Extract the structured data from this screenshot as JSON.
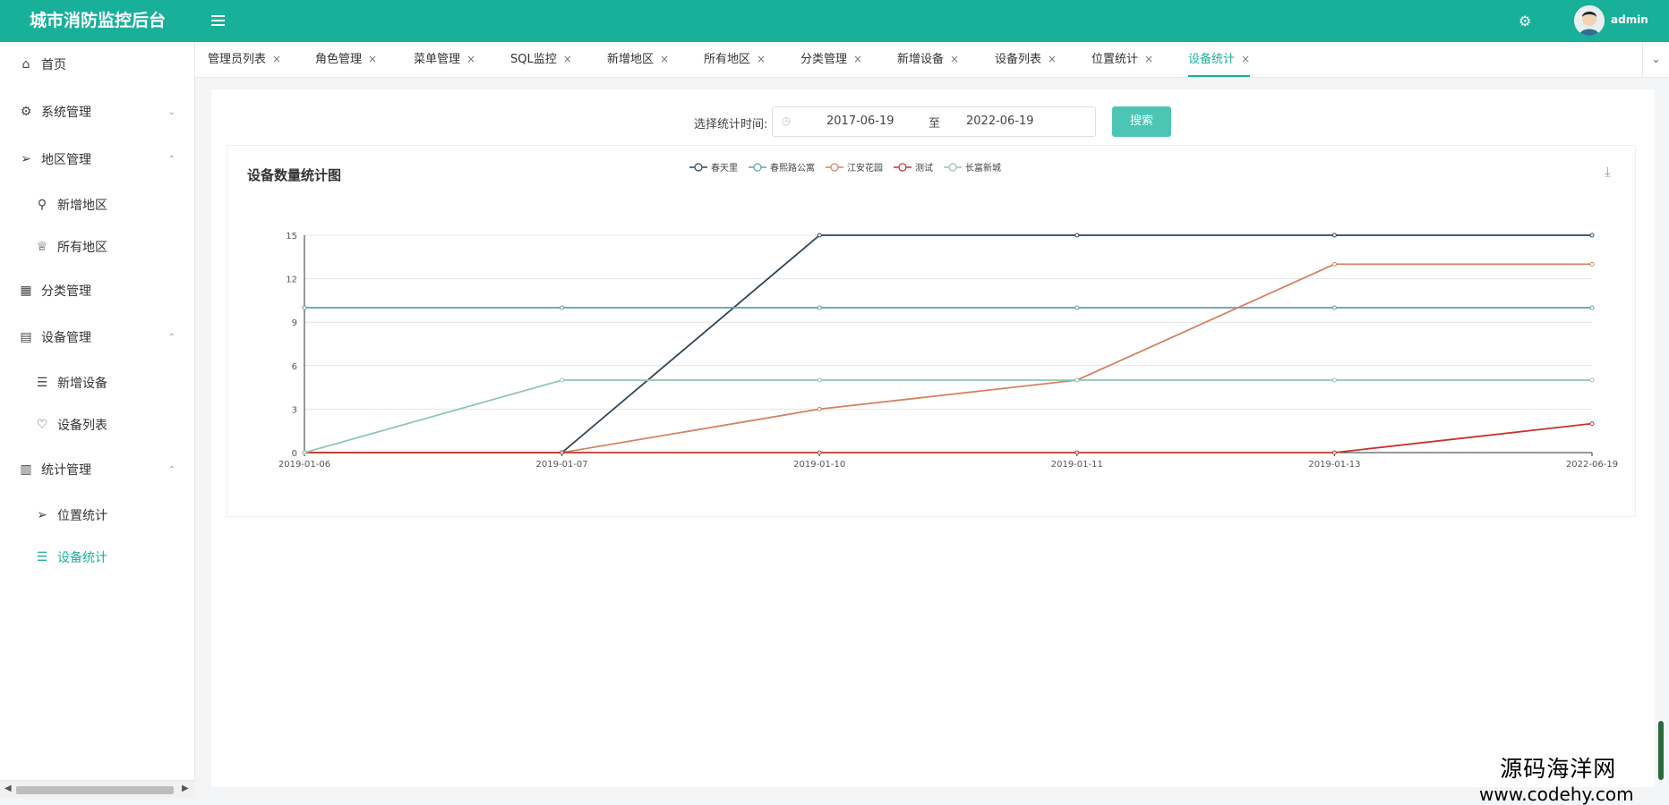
{
  "app": {
    "title": "城市消防监控后台",
    "username": "admin"
  },
  "sidebar": {
    "items": [
      {
        "label": "首页",
        "icon": "home-icon",
        "glyph": "⌂"
      },
      {
        "label": "系统管理",
        "icon": "gear-icon",
        "glyph": "⚙",
        "chevron": "⌄"
      },
      {
        "label": "地区管理",
        "icon": "send-icon",
        "glyph": "➢",
        "chevron": "⌃"
      },
      {
        "label": "新增地区",
        "icon": "location-icon",
        "glyph": "⚲"
      },
      {
        "label": "所有地区",
        "icon": "trophy-icon",
        "glyph": "♕"
      },
      {
        "label": "分类管理",
        "icon": "grid-icon",
        "glyph": "▦"
      },
      {
        "label": "设备管理",
        "icon": "document-icon",
        "glyph": "▤",
        "chevron": "⌃"
      },
      {
        "label": "新增设备",
        "icon": "list-icon",
        "glyph": "☰"
      },
      {
        "label": "设备列表",
        "icon": "heart-icon",
        "glyph": "♡"
      },
      {
        "label": "统计管理",
        "icon": "bar-chart-icon",
        "glyph": "▥",
        "chevron": "⌃"
      },
      {
        "label": "位置统计",
        "icon": "send-icon",
        "glyph": "➢"
      },
      {
        "label": "设备统计",
        "icon": "list-icon",
        "glyph": "☰",
        "active": true
      }
    ]
  },
  "tabs": [
    {
      "label": "管理员列表"
    },
    {
      "label": "角色管理"
    },
    {
      "label": "菜单管理"
    },
    {
      "label": "SQL监控"
    },
    {
      "label": "新增地区"
    },
    {
      "label": "所有地区"
    },
    {
      "label": "分类管理"
    },
    {
      "label": "新增设备"
    },
    {
      "label": "设备列表"
    },
    {
      "label": "位置统计"
    },
    {
      "label": "设备统计",
      "active": true
    }
  ],
  "tab_close": "×",
  "filter": {
    "label": "选择统计时间:",
    "start_date": "2017-06-19",
    "separator": "至",
    "end_date": "2022-06-19",
    "search_label": "搜索"
  },
  "chart_data": {
    "type": "line",
    "title": "设备数量统计图",
    "categories": [
      "2019-01-06",
      "2019-01-07",
      "2019-01-10",
      "2019-01-11",
      "2019-01-13",
      "2022-06-19"
    ],
    "ylim": [
      0,
      15
    ],
    "yticks": [
      0,
      3,
      6,
      9,
      12,
      15
    ],
    "grid": true,
    "legend_position": "top-center",
    "series": [
      {
        "name": "春天里",
        "color": "#2f4554",
        "values": [
          0,
          0,
          15,
          15,
          15,
          15
        ]
      },
      {
        "name": "春熙路公寓",
        "color": "#61a0a8",
        "values": [
          10,
          10,
          10,
          10,
          10,
          10
        ]
      },
      {
        "name": "江安花园",
        "color": "#d48265",
        "values": [
          0,
          0,
          3,
          5,
          13,
          13
        ]
      },
      {
        "name": "测试",
        "color": "#c23531",
        "values": [
          0,
          0,
          0,
          0,
          0,
          2
        ]
      },
      {
        "name": "长富新城",
        "color": "#91c7ae",
        "values": [
          0,
          5,
          5,
          5,
          5,
          5
        ]
      }
    ]
  },
  "watermark": {
    "line1": "源码海洋网",
    "line2": "www.codehy.com"
  }
}
